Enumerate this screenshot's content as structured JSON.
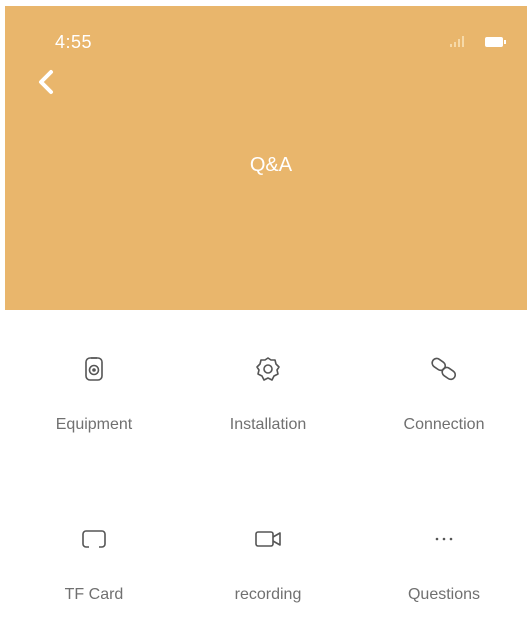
{
  "status_bar": {
    "time": "4:55"
  },
  "header": {
    "title": "Q&A",
    "back_icon": "chevron-left-icon",
    "bg_color": "#e9b66c"
  },
  "grid": {
    "items": [
      {
        "label": "Equipment",
        "icon": "device-icon"
      },
      {
        "label": "Installation",
        "icon": "gear-icon"
      },
      {
        "label": "Connection",
        "icon": "link-icon"
      },
      {
        "label": "TF Card",
        "icon": "card-icon"
      },
      {
        "label": "recording",
        "icon": "video-camera-icon"
      },
      {
        "label": "Questions",
        "icon": "more-dots-icon"
      }
    ]
  }
}
